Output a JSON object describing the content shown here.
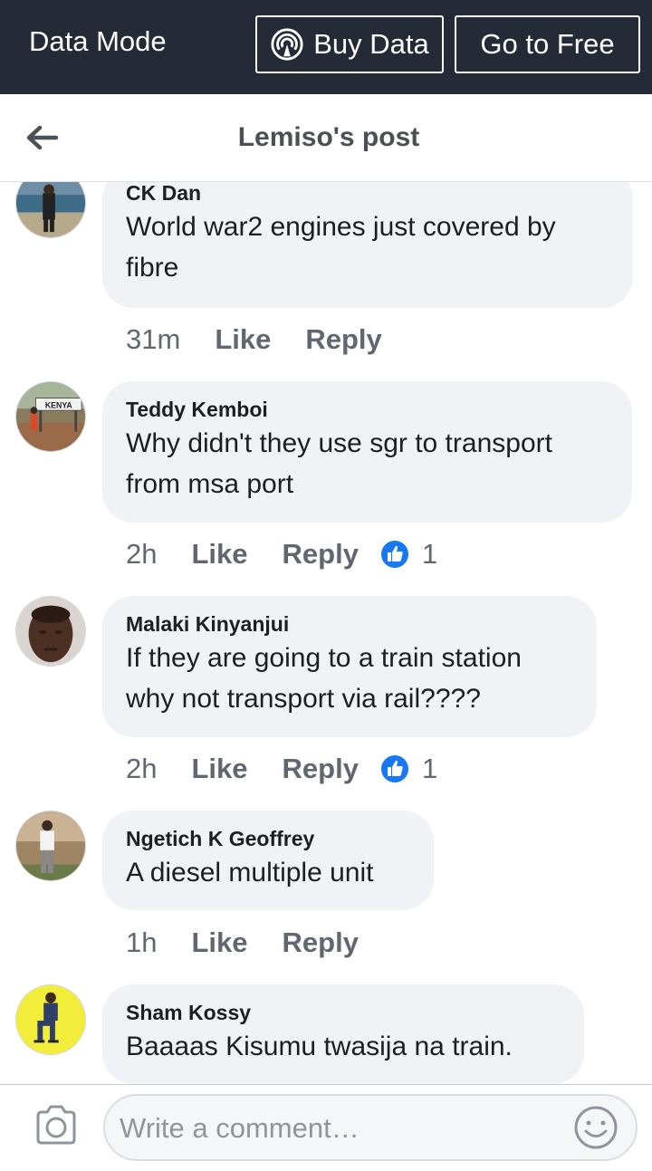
{
  "databar": {
    "mode_label": "Data Mode",
    "buy_label": "Buy Data",
    "free_label": "Go to Free"
  },
  "header": {
    "title": "Lemiso's post",
    "back_icon": "arrow-left-icon"
  },
  "comments": [
    {
      "author": "CK Dan",
      "text_lines": [
        "World war2 engines just covered by",
        "fibre"
      ],
      "time": "31m",
      "like_label": "Like",
      "reply_label": "Reply",
      "reactions": null
    },
    {
      "author": "Teddy Kemboi",
      "text_lines": [
        "Why didn't they use sgr to transport",
        "from msa port"
      ],
      "time": "2h",
      "like_label": "Like",
      "reply_label": "Reply",
      "reactions": "1"
    },
    {
      "author": "Malaki Kinyanjui",
      "text_lines": [
        "If they are going to a train station",
        "why not transport via rail????"
      ],
      "time": "2h",
      "like_label": "Like",
      "reply_label": "Reply",
      "reactions": "1"
    },
    {
      "author": "Ngetich K Geoffrey",
      "text_lines": [
        "A diesel multiple unit"
      ],
      "time": "1h",
      "like_label": "Like",
      "reply_label": "Reply",
      "reactions": null
    },
    {
      "author": "Sham Kossy",
      "text_lines": [
        "Baaaas Kisumu twasija na train."
      ],
      "time": "",
      "like_label": "",
      "reply_label": "",
      "reactions": null
    }
  ],
  "avatar_sign_text": "KENYA",
  "composer": {
    "placeholder": "Write a comment…",
    "camera_icon": "camera-icon",
    "emoji_icon": "smiley-icon"
  },
  "colors": {
    "databar_bg": "#242b36",
    "bubble_bg": "#f0f2f5",
    "like_blue": "#1877f2",
    "muted_text": "#606770"
  }
}
